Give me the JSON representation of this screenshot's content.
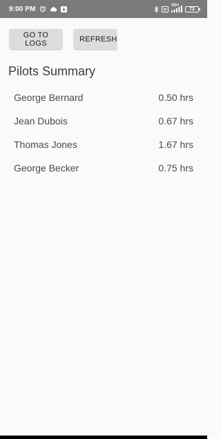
{
  "status_bar": {
    "time": "9:00 PM",
    "icons_left": [
      "alarm-icon",
      "cloud-icon",
      "download-notification-icon"
    ],
    "icons_right": [
      "bluetooth-icon",
      "sim-icon",
      "signal-icon"
    ],
    "network_type": "4G+",
    "battery_level": "72"
  },
  "toolbar": {
    "logs_label": "GO TO LOGS",
    "refresh_label": "REFRESH"
  },
  "summary": {
    "title": "Pilots Summary",
    "pilots": [
      {
        "name": "George Bernard",
        "hours": "0.50 hrs"
      },
      {
        "name": "Jean Dubois",
        "hours": "0.67 hrs"
      },
      {
        "name": "Thomas Jones",
        "hours": "1.67 hrs"
      },
      {
        "name": "George Becker",
        "hours": "0.75 hrs"
      }
    ]
  },
  "colors": {
    "status_bar_bg": "#7a7a7a",
    "background": "#fafafa",
    "button_bg": "#dcdcdc",
    "text": "#4a4a4a"
  }
}
